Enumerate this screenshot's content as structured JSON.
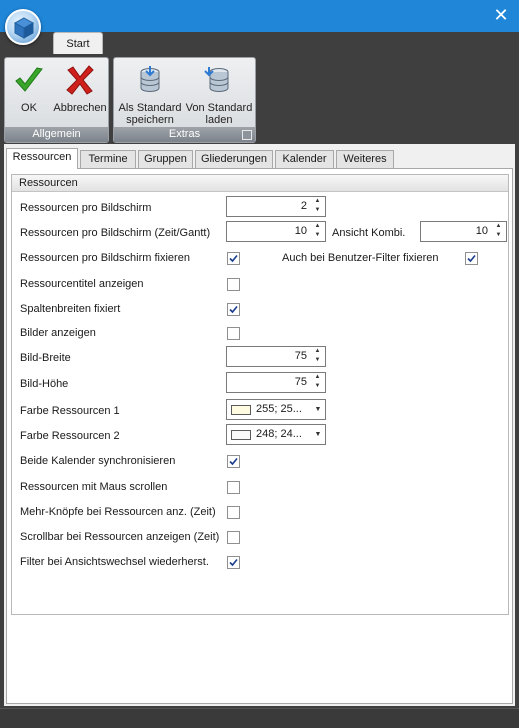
{
  "window": {
    "close_glyph": "✕",
    "app_icon": "cube-icon"
  },
  "ribbon": {
    "tab_label": "Start",
    "groups": [
      {
        "caption": "Allgemein",
        "buttons": [
          {
            "label": "OK",
            "icon": "checkmark-icon",
            "color": "#3aa52b"
          },
          {
            "label": "Abbrechen",
            "icon": "red-cross-icon",
            "color": "#d0201c"
          }
        ]
      },
      {
        "caption": "Extras",
        "buttons": [
          {
            "label_line1": "Als Standard",
            "label_line2": "speichern",
            "icon": "database-save-icon"
          },
          {
            "label_line1": "Von Standard",
            "label_line2": "laden",
            "icon": "database-load-icon"
          }
        ]
      }
    ]
  },
  "tabs": [
    "Ressourcen",
    "Termine",
    "Gruppen",
    "Gliederungen",
    "Kalender",
    "Weiteres"
  ],
  "active_tab": "Ressourcen",
  "group_title": "Ressourcen",
  "settings": {
    "per_screen": {
      "label": "Ressourcen pro Bildschirm",
      "value": "2"
    },
    "per_screen_time": {
      "label": "Ressourcen pro Bildschirm (Zeit/Gantt)",
      "value": "10"
    },
    "combi_view": {
      "label": "Ansicht Kombi.",
      "value": "10"
    },
    "fix_per_screen": {
      "label": "Ressourcen pro Bildschirm fixieren",
      "checked": true
    },
    "fix_user_filter": {
      "label": "Auch bei Benutzer-Filter fixieren",
      "checked": true
    },
    "show_title": {
      "label": "Ressourcentitel anzeigen",
      "checked": false
    },
    "column_width_fixed": {
      "label": "Spaltenbreiten fixiert",
      "checked": true
    },
    "show_images": {
      "label": "Bilder anzeigen",
      "checked": false
    },
    "image_width": {
      "label": "Bild-Breite",
      "value": "75"
    },
    "image_height": {
      "label": "Bild-Höhe",
      "value": "75"
    },
    "color1": {
      "label": "Farbe Ressourcen 1",
      "value": "255; 25...",
      "swatch": "#fffbe0"
    },
    "color2": {
      "label": "Farbe Ressourcen 2",
      "value": "248; 24...",
      "swatch": "#f8f8f8"
    },
    "sync_calendars": {
      "label": "Beide Kalender synchronisieren",
      "checked": true
    },
    "mouse_scroll": {
      "label": "Ressourcen mit Maus scrollen",
      "checked": false
    },
    "more_buttons": {
      "label": "Mehr-Knöpfe bei Ressourcen anz. (Zeit)",
      "checked": false
    },
    "scrollbar": {
      "label": "Scrollbar bei Ressourcen anzeigen (Zeit)",
      "checked": false
    },
    "restore_filter": {
      "label": "Filter bei Ansichtswechsel wiederherst.",
      "checked": true
    }
  }
}
